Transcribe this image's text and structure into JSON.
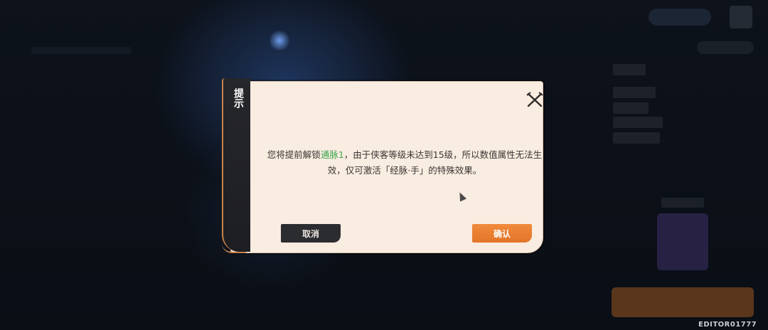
{
  "dialog": {
    "title": "提示",
    "message_prefix": "您将提前解锁",
    "message_highlight": "通脉1",
    "message_suffix": "，由于侠客等级未达到15级，所以数值属性无法生效，仅可激活「经脉·手」的特殊效果。",
    "cancel_label": "取消",
    "confirm_label": "确认",
    "close_icon": "crossed-swords-close-icon"
  },
  "footer": {
    "watermark": "EDITOR01777"
  },
  "colors": {
    "highlight": "#3aa64e",
    "confirm": "#e4752a",
    "cancel": "#2b2c30",
    "dialog_bg": "#f9ece0",
    "accent_trim": "#c8824a"
  }
}
